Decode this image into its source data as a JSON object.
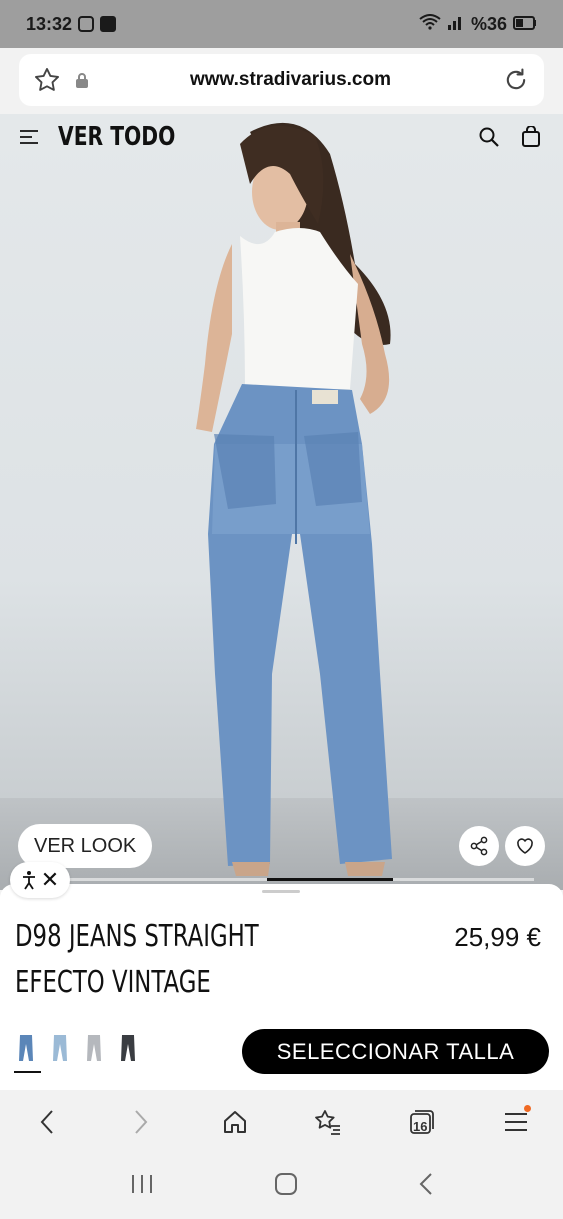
{
  "status_bar": {
    "time": "13:32",
    "battery": "%36"
  },
  "browser": {
    "url": "www.stradivarius.com"
  },
  "site_header": {
    "title": "VER TODO"
  },
  "gallery": {
    "ver_look_label": "VER LOOK",
    "progress": 0.25
  },
  "product": {
    "name_line1": "D98 JEANS STRAIGHT",
    "name_line2": "EFECTO VINTAGE",
    "price": "25,99 €",
    "select_size_label": "SELECCIONAR TALLA",
    "swatch_colors": [
      "#5b86b8",
      "#9bbad6",
      "#b5b8bd",
      "#3a3d42"
    ]
  },
  "toolbar": {
    "tab_count": "16"
  },
  "colors": {
    "accent_dot": "#f06a24",
    "primary": "#000000"
  }
}
